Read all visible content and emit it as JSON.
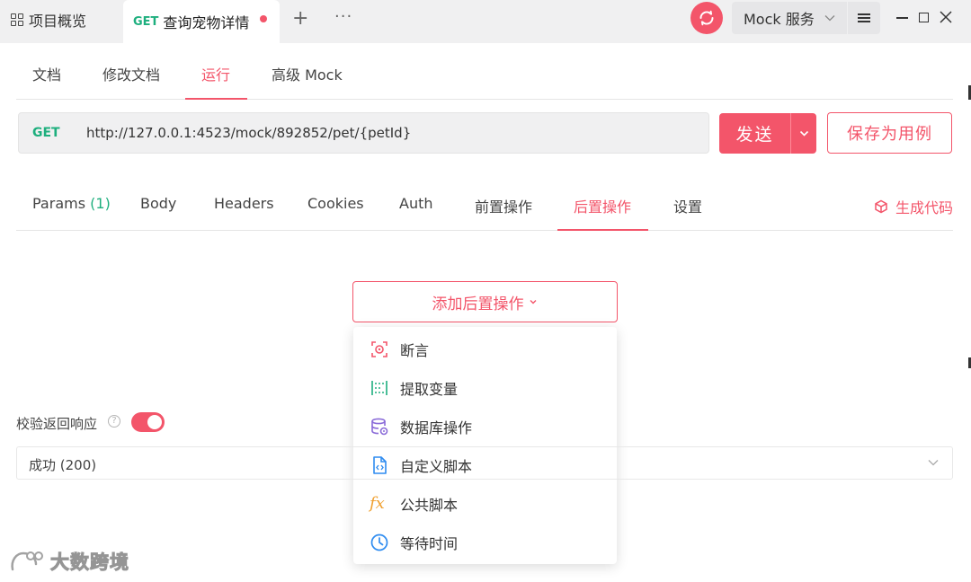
{
  "titlebar": {
    "overview_tab": "项目概览",
    "active_tab": {
      "method": "GET",
      "title": "查询宠物详情",
      "unsaved": true
    },
    "mock_service": "Mock 服务",
    "icons": [
      "grid-icon",
      "plus-icon",
      "more-icon",
      "sync-icon",
      "chevron-down-icon",
      "menu-icon",
      "minimize-icon",
      "maximize-icon",
      "close-icon"
    ]
  },
  "doc_tabs": [
    {
      "label": "文档",
      "active": false
    },
    {
      "label": "修改文档",
      "active": false
    },
    {
      "label": "运行",
      "active": true
    },
    {
      "label": "高级 Mock",
      "active": false
    }
  ],
  "request": {
    "method": "GET",
    "url": "http://127.0.0.1:4523/mock/892852/pet/{petId}",
    "send_label": "发送",
    "save_label": "保存为用例"
  },
  "request_tabs": {
    "params_label": "Params",
    "params_count": "(1)",
    "items": [
      {
        "label": "Body"
      },
      {
        "label": "Headers"
      },
      {
        "label": "Cookies"
      },
      {
        "label": "Auth"
      },
      {
        "label": "前置操作"
      },
      {
        "label": "后置操作",
        "active": true
      },
      {
        "label": "设置"
      }
    ],
    "generate_code": "生成代码"
  },
  "post_ops": {
    "add_label": "添加后置操作",
    "menu": [
      {
        "label": "断言",
        "icon": "assertion-icon",
        "color": "#f3556a"
      },
      {
        "label": "提取变量",
        "icon": "extract-variable-icon",
        "color": "#1eaf7e"
      },
      {
        "label": "数据库操作",
        "icon": "database-icon",
        "color": "#8a6bd8"
      },
      {
        "label": "自定义脚本",
        "icon": "script-file-icon",
        "color": "#2f8cf0"
      },
      {
        "label": "公共脚本",
        "icon": "fx-icon",
        "color": "#f0a030",
        "glyph": "fx"
      },
      {
        "label": "等待时间",
        "icon": "clock-icon",
        "color": "#2f8cf0"
      }
    ]
  },
  "validate": {
    "label": "校验返回响应",
    "enabled": true,
    "response_option": "成功 (200)"
  },
  "watermark": "大数跨境",
  "colors": {
    "accent": "#f3556a",
    "get_method": "#1eaf7e"
  }
}
